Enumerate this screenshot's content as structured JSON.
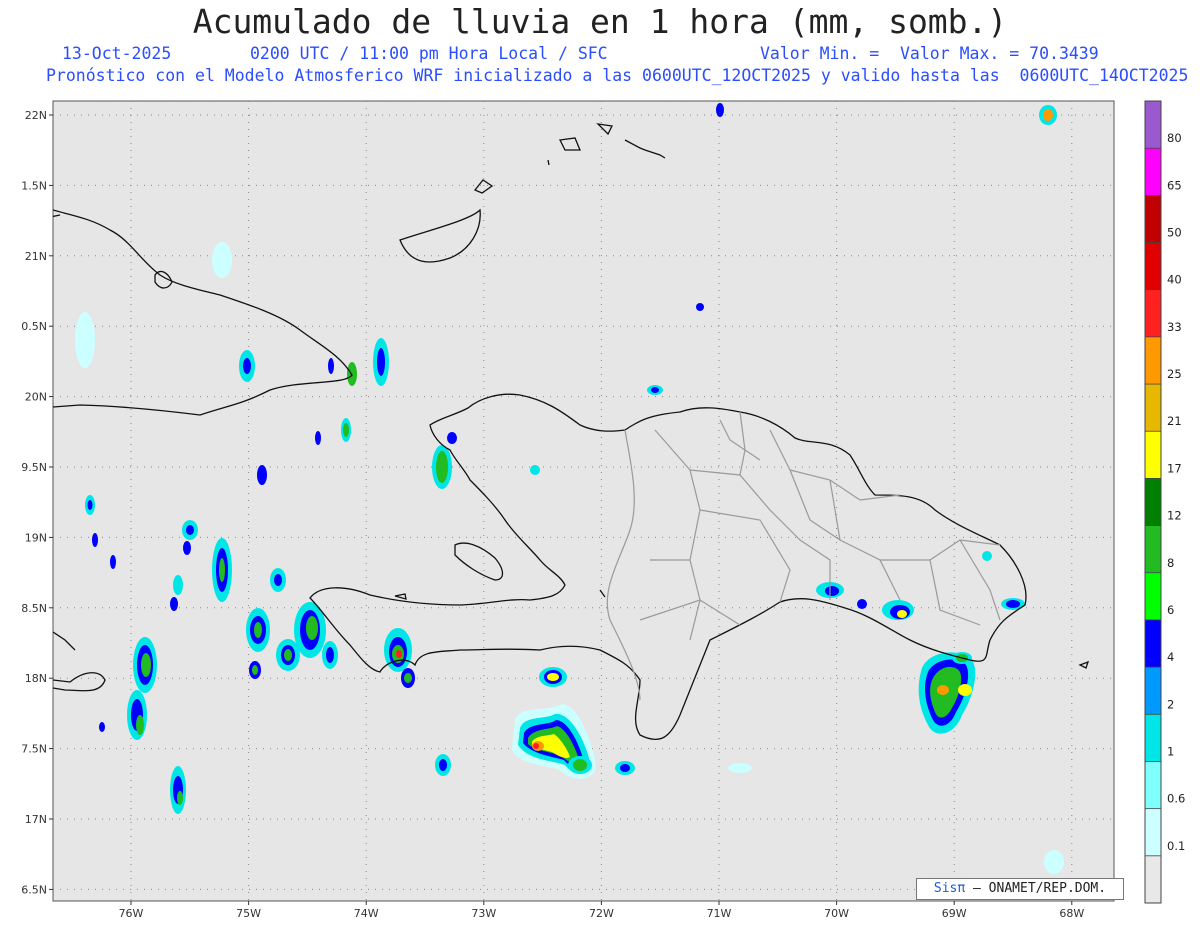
{
  "title": "Acumulado de lluvia en 1 hora (mm, somb.)",
  "subtitle": {
    "date": "13-Oct-2025",
    "time": "0200 UTC / 11:00 pm Hora Local / SFC",
    "min_label": "Valor Min. =",
    "max_label": "Valor Max. = 70.3439",
    "model_line": "Pronóstico con el Modelo Atmosferico WRF inicializado a las 0600UTC_12OCT2025 y valido hasta las  0600UTC_14OCT2025"
  },
  "axes": {
    "lat_labels": [
      "22N",
      "1.5N",
      "21N",
      "0.5N",
      "20N",
      "9.5N",
      "19N",
      "8.5N",
      "18N",
      "7.5N",
      "17N",
      "6.5N"
    ],
    "lon_labels": [
      "76W",
      "75W",
      "74W",
      "73W",
      "72W",
      "71W",
      "70W",
      "69W",
      "68W"
    ]
  },
  "legend": {
    "labels": [
      "80",
      "65",
      "50",
      "40",
      "33",
      "25",
      "21",
      "17",
      "12",
      "8",
      "6",
      "4",
      "2",
      "1",
      "0.6",
      "0.1"
    ],
    "colors": [
      "#9b59d0",
      "#ff00ff",
      "#c00000",
      "#e00000",
      "#ff2020",
      "#ff9900",
      "#e6b800",
      "#ffff00",
      "#008000",
      "#22bb22",
      "#00ff00",
      "#0000ff",
      "#0099ff",
      "#00e6e6",
      "#80ffff",
      "#ccffff",
      "#e8e8e8"
    ]
  },
  "credit": {
    "brand": "Sisπ",
    "text": "– ONAMET/REP.DOM."
  }
}
